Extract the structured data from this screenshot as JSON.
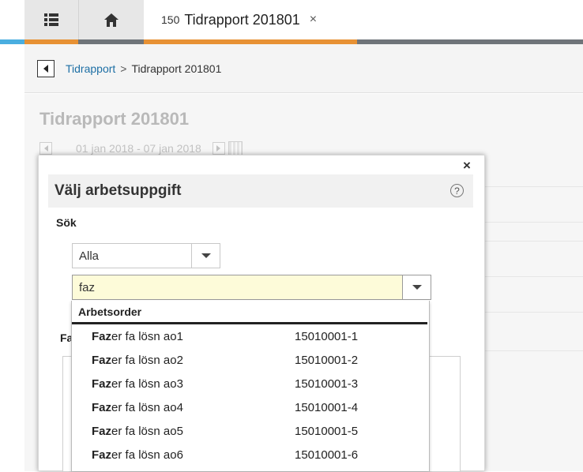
{
  "tabs": {
    "active_count": "150",
    "active_title": "Tidrapport 201801",
    "close_glyph": "×"
  },
  "breadcrumb": {
    "link": "Tidrapport",
    "separator": ">",
    "current": "Tidrapport 201801"
  },
  "page": {
    "title": "Tidrapport 201801",
    "date_range": "01 jan 2018 - 07 jan 2018"
  },
  "modal": {
    "title": "Välj arbetsuppgift",
    "close_glyph": "×",
    "help_glyph": "?",
    "search_label": "Sök",
    "filter_value": "Alla",
    "search_value": "faz",
    "behind_label": "Fa"
  },
  "dropdown": {
    "header": "Arbetsorder",
    "items": [
      {
        "match": "Faz",
        "rest": "er fa lösn ao1",
        "code": "15010001-1"
      },
      {
        "match": "Faz",
        "rest": "er fa lösn ao2",
        "code": "15010001-2"
      },
      {
        "match": "Faz",
        "rest": "er fa lösn ao3",
        "code": "15010001-3"
      },
      {
        "match": "Faz",
        "rest": "er fa lösn ao4",
        "code": "15010001-4"
      },
      {
        "match": "Faz",
        "rest": "er fa lösn ao5",
        "code": "15010001-5"
      },
      {
        "match": "Faz",
        "rest": "er fa lösn ao6",
        "code": "15010001-6"
      }
    ]
  },
  "colors": {
    "accent_orange": "#e79134",
    "accent_blue": "#4aaee0",
    "link_blue": "#1d6fa5",
    "search_highlight": "#fdfbd9"
  }
}
